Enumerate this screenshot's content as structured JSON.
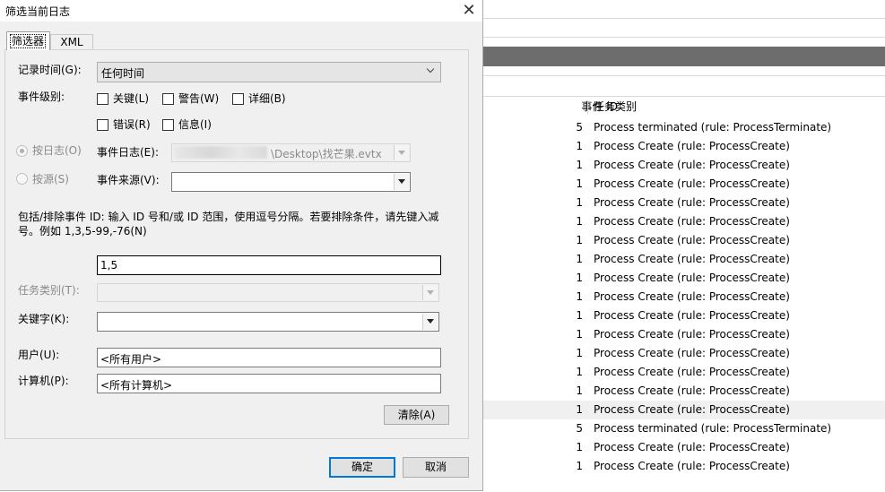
{
  "window": {
    "title": "筛选当前日志",
    "close_glyph": "✕"
  },
  "tabs": [
    {
      "label": "筛选器"
    },
    {
      "label": "XML"
    }
  ],
  "form": {
    "logged_label": "记录时间(G):",
    "logged_value": "任何时间",
    "level_label": "事件级别:",
    "levels": [
      {
        "label": "关键(L)",
        "checked": false
      },
      {
        "label": "警告(W)",
        "checked": false
      },
      {
        "label": "详细(B)",
        "checked": false
      },
      {
        "label": "错误(R)",
        "checked": false
      },
      {
        "label": "信息(I)",
        "checked": false
      }
    ],
    "by_log_label": "按日志(O)",
    "by_source_label": "按源(S)",
    "event_logs_label": "事件日志(E):",
    "event_logs_value": "\\Desktop\\找芒果.evtx",
    "event_sources_label": "事件来源(V):",
    "event_sources_value": "",
    "id_help": "包括/排除事件 ID: 输入 ID 号和/或 ID 范围，使用逗号分隔。若要排除条件，请先键入减号。例如 1,3,5-99,-76(N)",
    "id_value": "1,5",
    "task_category_label": "任务类别(T):",
    "keywords_label": "关键字(K):",
    "user_label": "用户(U):",
    "user_value": "<所有用户>",
    "computer_label": "计算机(P):",
    "computer_value": "<所有计算机>",
    "clear_label": "清除(A)",
    "ok_label": "确定",
    "cancel_label": "取消"
  },
  "event_list": {
    "headers": {
      "id": "事件 ID",
      "category": "任务类别"
    },
    "rows": [
      {
        "id": "5",
        "category": "Process terminated (rule: ProcessTerminate)"
      },
      {
        "id": "1",
        "category": "Process Create (rule: ProcessCreate)"
      },
      {
        "id": "1",
        "category": "Process Create (rule: ProcessCreate)"
      },
      {
        "id": "1",
        "category": "Process Create (rule: ProcessCreate)"
      },
      {
        "id": "1",
        "category": "Process Create (rule: ProcessCreate)"
      },
      {
        "id": "1",
        "category": "Process Create (rule: ProcessCreate)"
      },
      {
        "id": "1",
        "category": "Process Create (rule: ProcessCreate)"
      },
      {
        "id": "1",
        "category": "Process Create (rule: ProcessCreate)"
      },
      {
        "id": "1",
        "category": "Process Create (rule: ProcessCreate)"
      },
      {
        "id": "1",
        "category": "Process Create (rule: ProcessCreate)"
      },
      {
        "id": "1",
        "category": "Process Create (rule: ProcessCreate)"
      },
      {
        "id": "1",
        "category": "Process Create (rule: ProcessCreate)"
      },
      {
        "id": "1",
        "category": "Process Create (rule: ProcessCreate)"
      },
      {
        "id": "1",
        "category": "Process Create (rule: ProcessCreate)"
      },
      {
        "id": "1",
        "category": "Process Create (rule: ProcessCreate)"
      },
      {
        "id": "1",
        "category": "Process Create (rule: ProcessCreate)",
        "selected": true
      },
      {
        "id": "5",
        "category": "Process terminated (rule: ProcessTerminate)"
      },
      {
        "id": "1",
        "category": "Process Create (rule: ProcessCreate)"
      },
      {
        "id": "1",
        "category": "Process Create (rule: ProcessCreate)"
      }
    ]
  },
  "colors": {
    "dialog_bg": "#f0f0f0",
    "accent": "#0078d7",
    "header_bar": "#6d6d6d"
  }
}
